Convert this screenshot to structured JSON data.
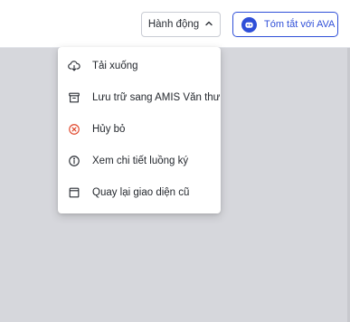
{
  "header": {
    "actions_label": "Hành động",
    "ava_label": "Tóm tắt với AVA"
  },
  "menu": {
    "items": [
      {
        "label": "Tải xuống",
        "icon": "cloud-download-icon"
      },
      {
        "label": "Lưu trữ sang AMIS Văn thư",
        "icon": "archive-box-icon"
      },
      {
        "label": "Hủy bỏ",
        "icon": "cancel-circle-icon"
      },
      {
        "label": "Xem chi tiết luồng ký",
        "icon": "info-circle-icon"
      },
      {
        "label": "Quay lại giao diện cũ",
        "icon": "window-icon"
      }
    ]
  },
  "colors": {
    "accent": "#2f4fd8",
    "danger": "#e0462a",
    "backdrop": "#d6d7dc"
  }
}
